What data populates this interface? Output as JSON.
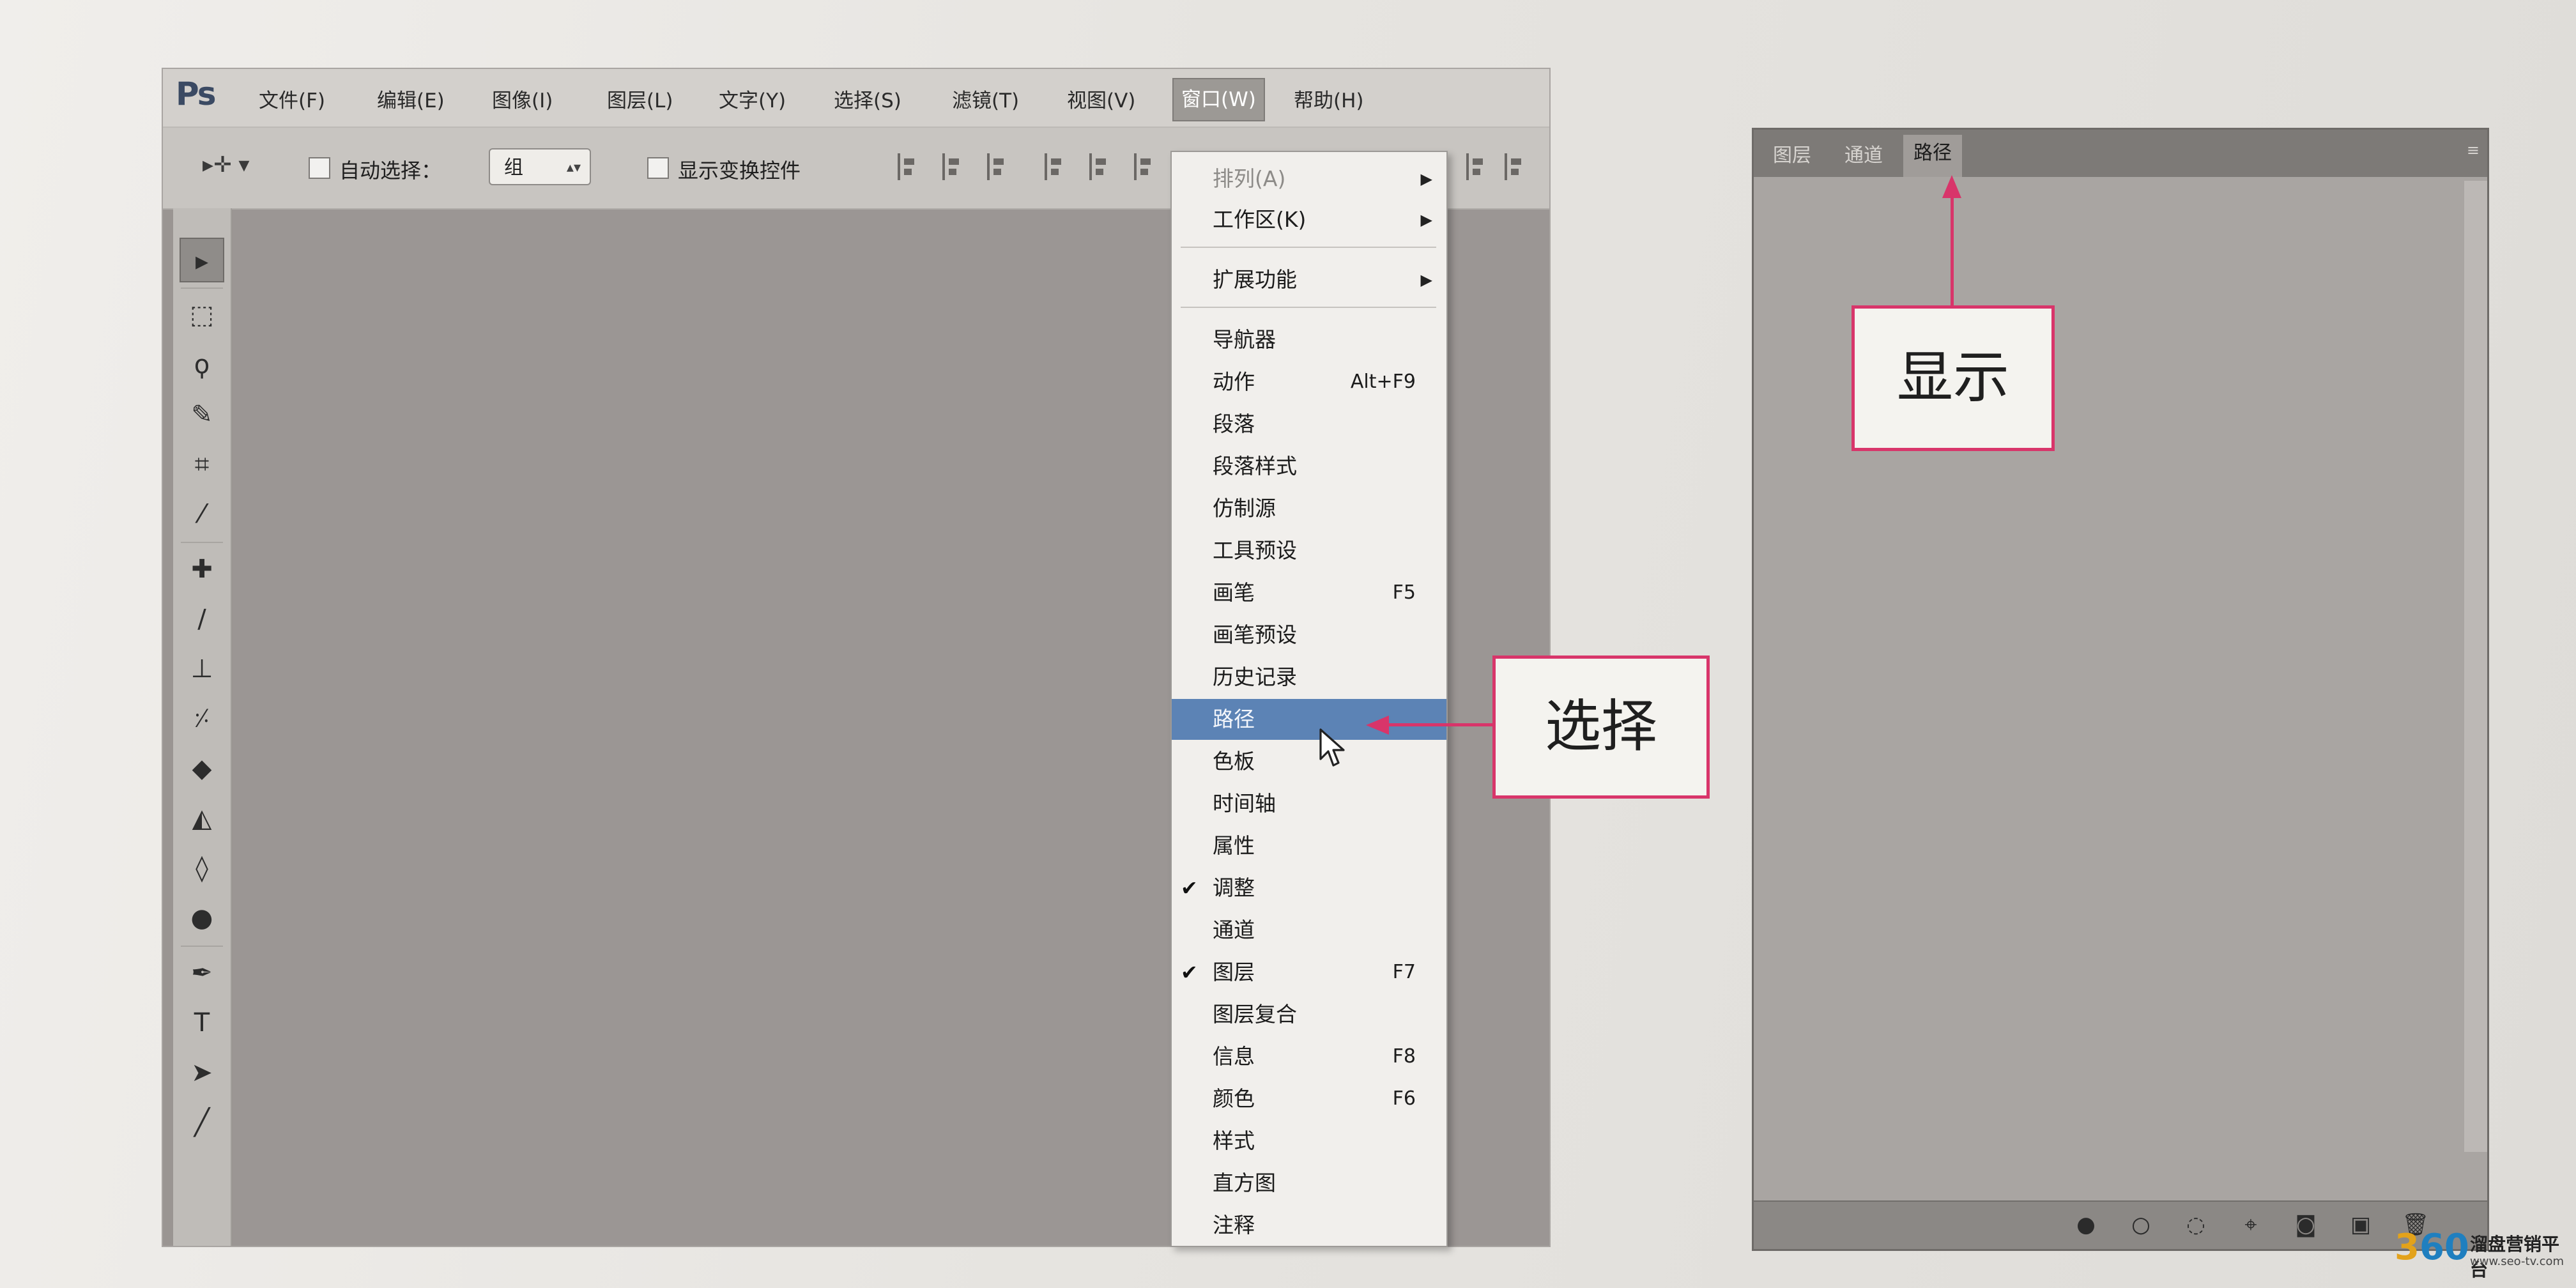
{
  "app": {
    "logo": "Ps"
  },
  "menubar": {
    "items": [
      {
        "label": "文件(F)"
      },
      {
        "label": "编辑(E)"
      },
      {
        "label": "图像(I)"
      },
      {
        "label": "图层(L)"
      },
      {
        "label": "文字(Y)"
      },
      {
        "label": "选择(S)"
      },
      {
        "label": "滤镜(T)"
      },
      {
        "label": "视图(V)"
      },
      {
        "label": "窗口(W)",
        "active": true
      },
      {
        "label": "帮助(H)"
      }
    ]
  },
  "options_bar": {
    "move_tool_icon": "move-arrow",
    "auto_select_label": "自动选择：",
    "auto_select_value": "组",
    "show_transform_label": "显示变换控件"
  },
  "window_menu": {
    "items": [
      {
        "label": "排列(A)",
        "disabled": true,
        "submenu": true
      },
      {
        "label": "工作区(K)",
        "submenu": true
      },
      {
        "label": "扩展功能",
        "submenu": true
      },
      {
        "label": "导航器"
      },
      {
        "label": "动作",
        "shortcut": "Alt+F9"
      },
      {
        "label": "段落"
      },
      {
        "label": "段落样式"
      },
      {
        "label": "仿制源"
      },
      {
        "label": "工具预设"
      },
      {
        "label": "画笔",
        "shortcut": "F5"
      },
      {
        "label": "画笔预设"
      },
      {
        "label": "历史记录"
      },
      {
        "label": "路径",
        "highlighted": true
      },
      {
        "label": "色板"
      },
      {
        "label": "时间轴"
      },
      {
        "label": "属性"
      },
      {
        "label": "调整",
        "checked": true
      },
      {
        "label": "通道"
      },
      {
        "label": "图层",
        "checked": true,
        "shortcut": "F7"
      },
      {
        "label": "图层复合"
      },
      {
        "label": "信息",
        "shortcut": "F8"
      },
      {
        "label": "颜色",
        "shortcut": "F6"
      },
      {
        "label": "样式"
      },
      {
        "label": "直方图"
      },
      {
        "label": "注释"
      }
    ],
    "check_mark": "✔",
    "submenu_arrow": "▶"
  },
  "callouts": {
    "select": "选择",
    "show": "显示"
  },
  "paths_panel": {
    "tabs": [
      {
        "label": "图层"
      },
      {
        "label": "通道"
      },
      {
        "label": "路径",
        "active": true
      }
    ],
    "menu_icon": "≡"
  },
  "watermark": {
    "logo_num": "3",
    "logo_num2": "60",
    "name": "溜盘营销平台",
    "url": "www.seo-tv.com"
  },
  "colors": {
    "accent_callout": "#d8356a",
    "menu_highlight": "#5c83b5"
  }
}
